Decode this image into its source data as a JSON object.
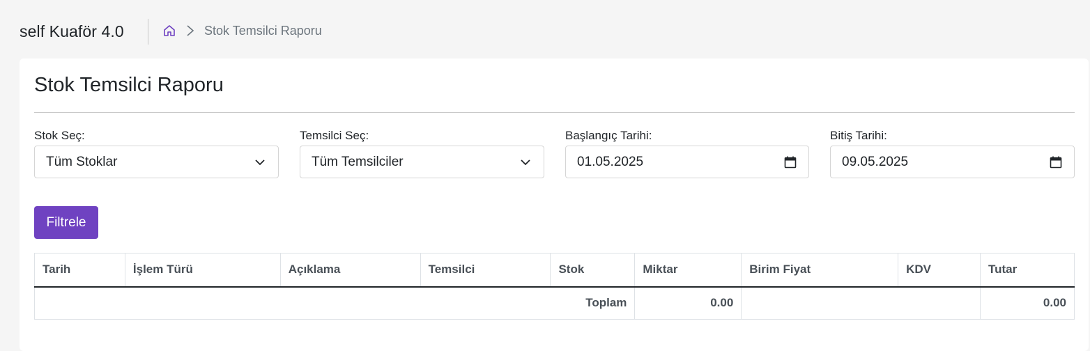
{
  "header": {
    "brand": "self Kuaför 4.0",
    "breadcrumb_current": "Stok Temsilci Raporu"
  },
  "page": {
    "title": "Stok Temsilci Raporu"
  },
  "filters": {
    "stock_label": "Stok Seç:",
    "stock_value": "Tüm Stoklar",
    "rep_label": "Temsilci Seç:",
    "rep_value": "Tüm Temsilciler",
    "start_label": "Başlangıç Tarihi:",
    "start_value": "01.05.2025",
    "end_label": "Bitiş Tarihi:",
    "end_value": "09.05.2025",
    "filter_button": "Filtrele"
  },
  "table": {
    "columns": [
      "Tarih",
      "İşlem Türü",
      "Açıklama",
      "Temsilci",
      "Stok",
      "Miktar",
      "Birim Fiyat",
      "KDV",
      "Tutar"
    ],
    "footer": {
      "total_label": "Toplam",
      "total_quantity": "0.00",
      "total_amount": "0.00"
    }
  },
  "colors": {
    "accent": "#6f42c1",
    "background": "#f5f5f5"
  },
  "icons": {
    "home": "home-icon",
    "separator": "chevron-right-icon",
    "select": "chevron-down-icon",
    "date": "calendar-icon"
  }
}
